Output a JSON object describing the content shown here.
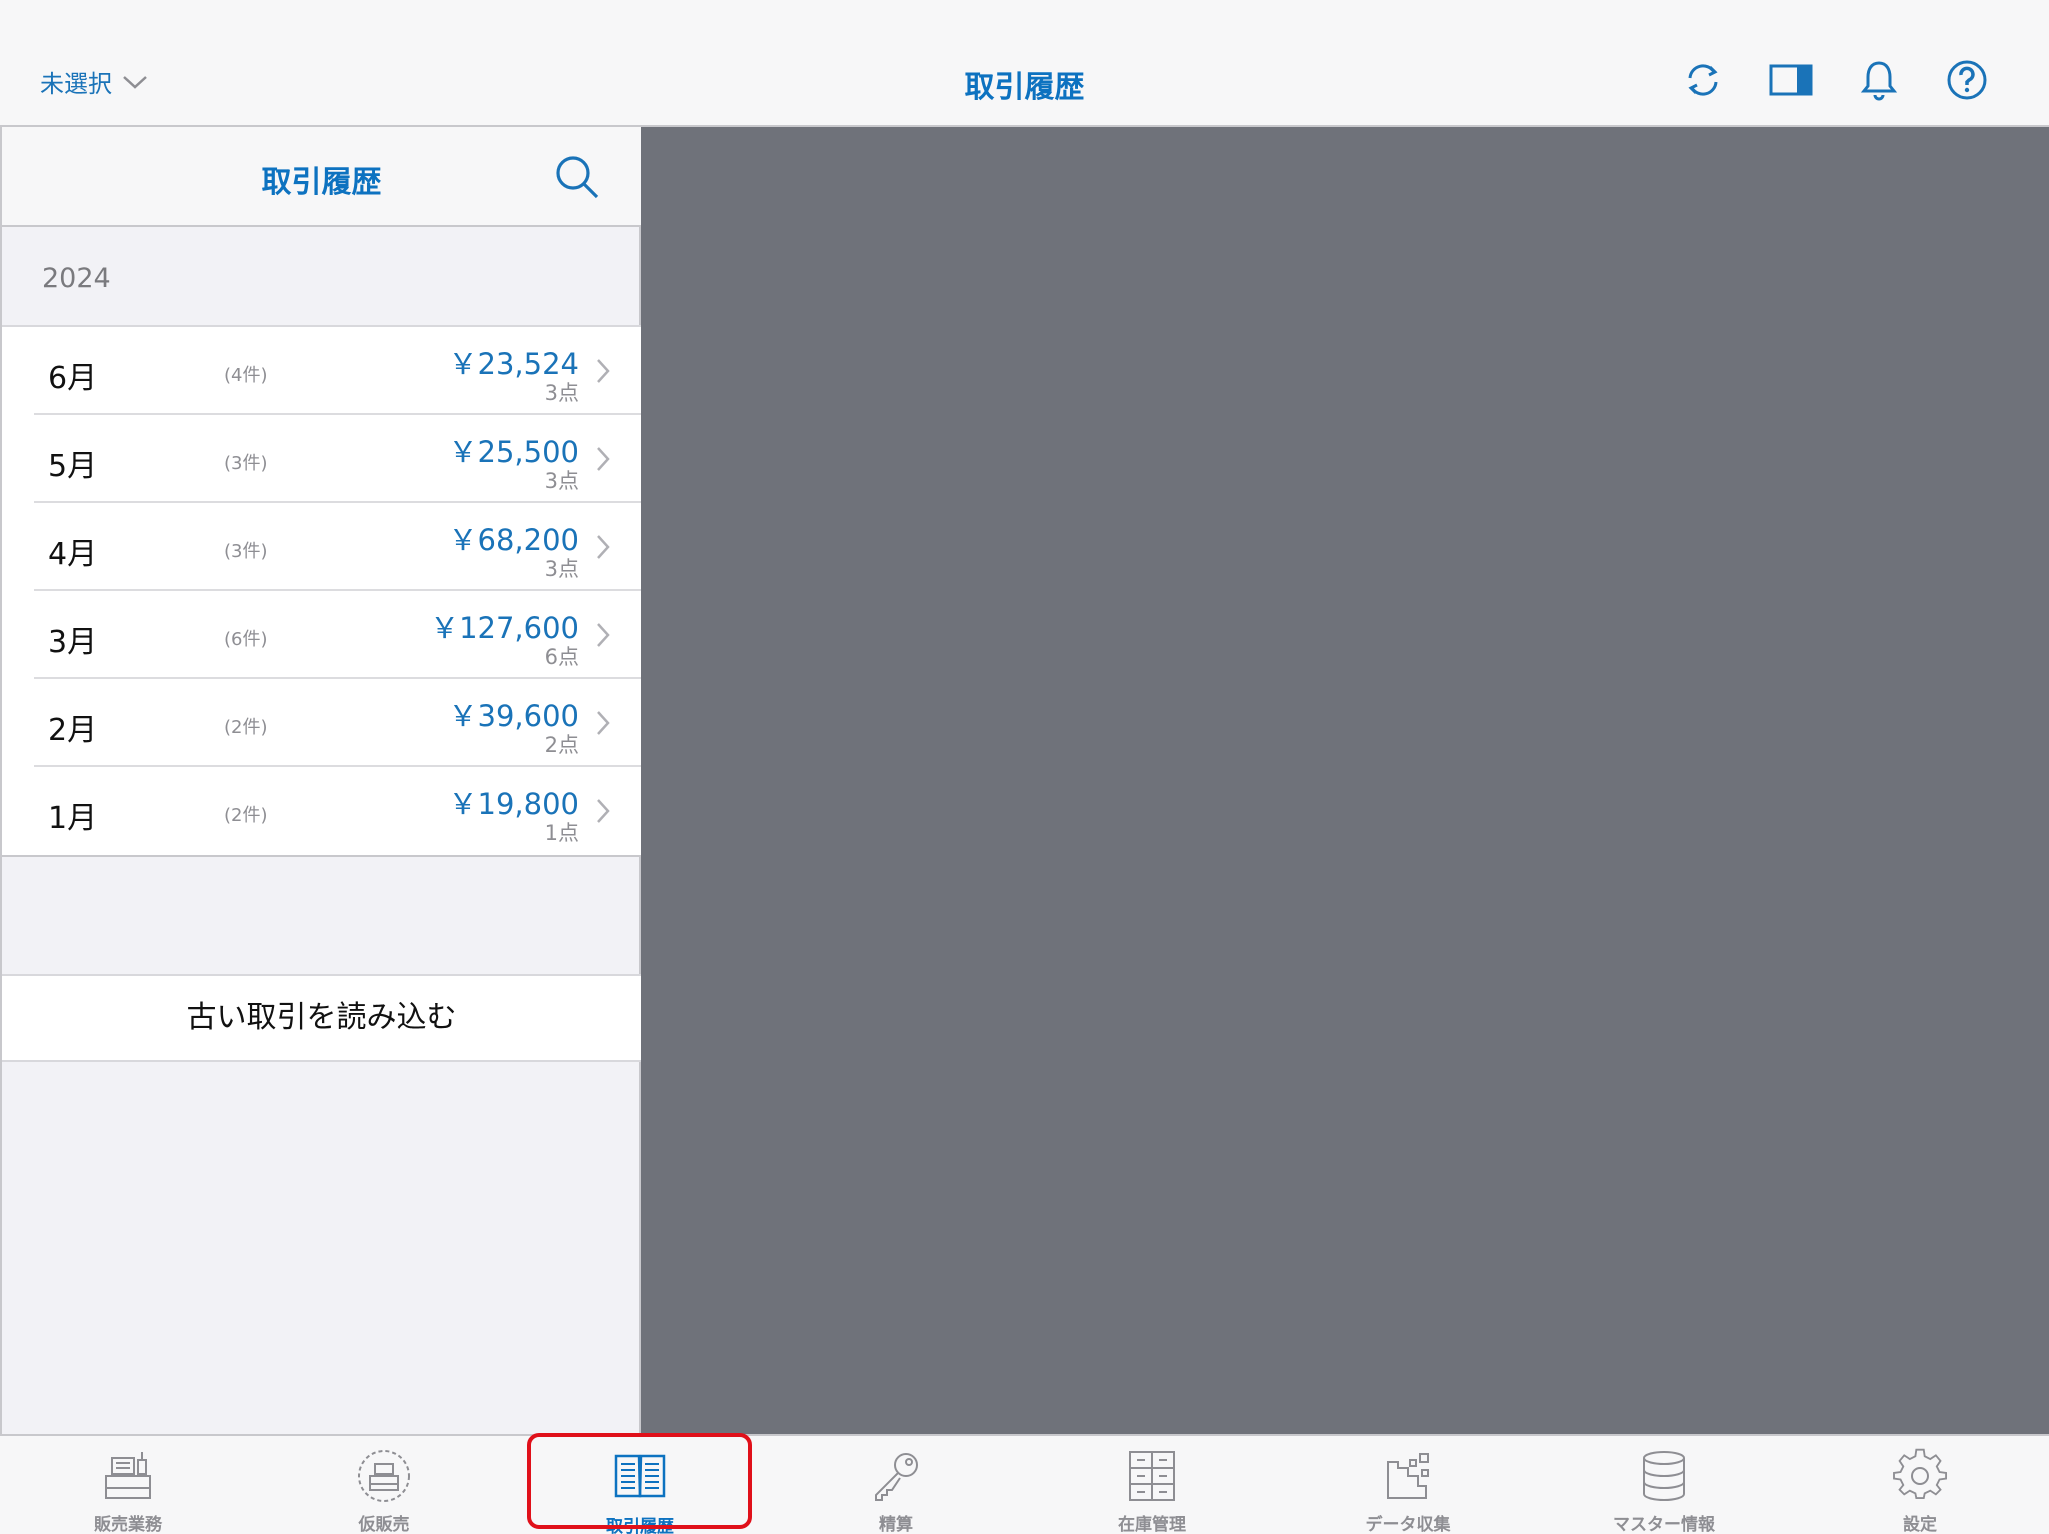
{
  "topbar": {
    "store_select": "未選択",
    "title": "取引履歴",
    "icons": [
      "refresh-icon",
      "split-view-icon",
      "bell-icon",
      "help-icon"
    ]
  },
  "left_panel": {
    "title": "取引履歴",
    "search_icon": "search-icon",
    "year": "2024",
    "months": [
      {
        "month": "6月",
        "count": "(4件)",
        "amount": "￥23,524",
        "qty": "3点"
      },
      {
        "month": "5月",
        "count": "(3件)",
        "amount": "￥25,500",
        "qty": "3点"
      },
      {
        "month": "4月",
        "count": "(3件)",
        "amount": "￥68,200",
        "qty": "3点"
      },
      {
        "month": "3月",
        "count": "(6件)",
        "amount": "￥127,600",
        "qty": "6点"
      },
      {
        "month": "2月",
        "count": "(2件)",
        "amount": "￥39,600",
        "qty": "2点"
      },
      {
        "month": "1月",
        "count": "(2件)",
        "amount": "￥19,800",
        "qty": "1点"
      }
    ],
    "load_old": "古い取引を読み込む"
  },
  "tabbar": {
    "tabs": [
      {
        "label": "販売業務",
        "icon": "register-icon"
      },
      {
        "label": "仮販売",
        "icon": "temp-sale-icon"
      },
      {
        "label": "取引履歴",
        "icon": "book-icon",
        "active": true
      },
      {
        "label": "精算",
        "icon": "key-icon"
      },
      {
        "label": "在庫管理",
        "icon": "cabinet-icon"
      },
      {
        "label": "データ収集",
        "icon": "data-collect-icon"
      },
      {
        "label": "マスター情報",
        "icon": "database-icon"
      },
      {
        "label": "設定",
        "icon": "gear-icon"
      }
    ]
  },
  "colors": {
    "accent": "#0d72c0",
    "amount": "#1a73b8",
    "detail_bg": "#6f727a",
    "highlight": "#e0101a"
  }
}
